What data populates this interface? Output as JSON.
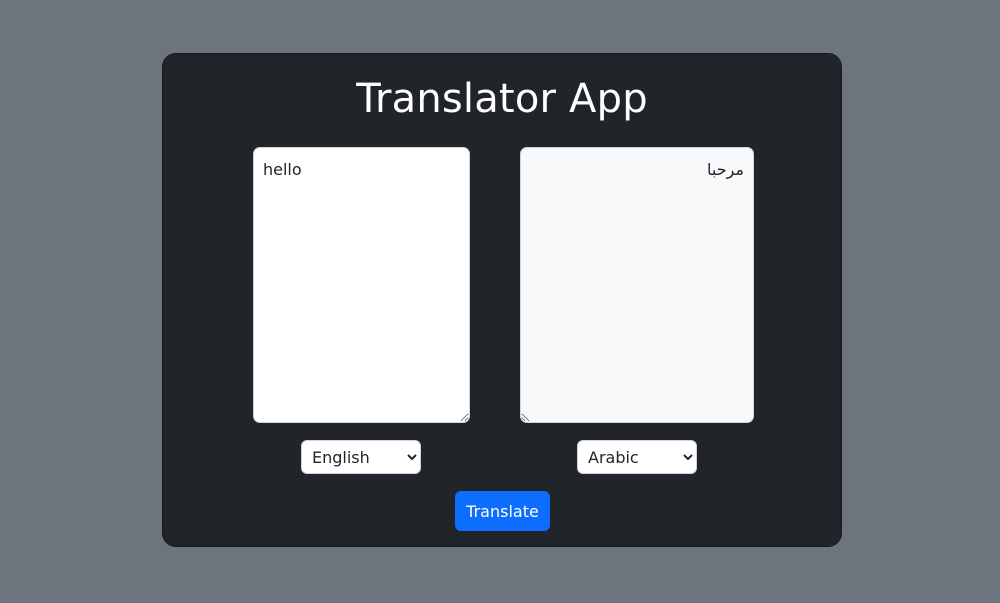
{
  "app": {
    "title": "Translator App"
  },
  "source": {
    "text": "hello",
    "language": "English",
    "language_options": [
      "English"
    ]
  },
  "target": {
    "text": "مرحبا",
    "language": "Arabic",
    "language_options": [
      "Arabic"
    ]
  },
  "actions": {
    "translate_label": "Translate"
  },
  "colors": {
    "page_background": "#6c757d",
    "card_background": "#212529",
    "button_primary": "#0d6efd",
    "target_textarea_background": "#f8f9fa"
  }
}
